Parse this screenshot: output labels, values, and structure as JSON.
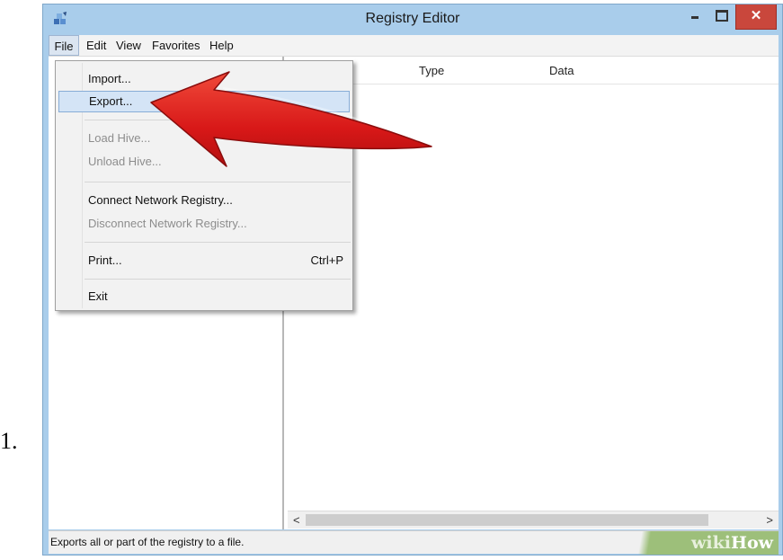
{
  "step_number": "1.",
  "window": {
    "title": "Registry Editor",
    "close_glyph": "✕"
  },
  "menubar": [
    "File",
    "Edit",
    "View",
    "Favorites",
    "Help"
  ],
  "file_menu": {
    "items": [
      {
        "label": "Import...",
        "enabled": true
      },
      {
        "label": "Export...",
        "enabled": true,
        "highlighted": true
      },
      {
        "label": "Load Hive...",
        "enabled": false
      },
      {
        "label": "Unload Hive...",
        "enabled": false
      },
      {
        "label": "Connect Network Registry...",
        "enabled": true
      },
      {
        "label": "Disconnect Network Registry...",
        "enabled": false
      },
      {
        "label": "Print...",
        "enabled": true,
        "shortcut": "Ctrl+P"
      },
      {
        "label": "Exit",
        "enabled": true
      }
    ]
  },
  "list_columns": [
    "Type",
    "Data"
  ],
  "scrollbar": {
    "left_arrow": "<",
    "right_arrow": ">"
  },
  "status_text": "Exports all or part of the registry to a file.",
  "watermark": {
    "part1": "wiki",
    "part2": "How"
  },
  "colors": {
    "titlebar": "#a9cdeb",
    "close_button": "#c9473c",
    "menu_highlight": "#d4e4f6",
    "arrow": "#e01f1f",
    "watermark_bg": "#9dbf7a"
  },
  "icons": [
    "registry-editor-app-icon",
    "minimize-icon",
    "maximize-icon",
    "close-icon",
    "red-arrow-pointer"
  ]
}
